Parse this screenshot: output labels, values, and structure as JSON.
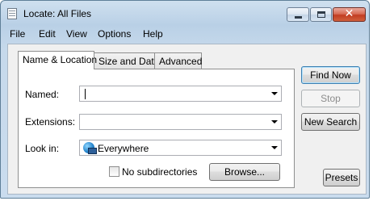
{
  "window": {
    "title": "Locate: All Files",
    "icon": "document-icon",
    "caption_buttons": [
      "minimize",
      "maximize",
      "close"
    ],
    "close_glyph": "✕"
  },
  "menu": [
    "File",
    "Edit",
    "View",
    "Options",
    "Help"
  ],
  "tabs": [
    {
      "label": "Name & Location",
      "active": true
    },
    {
      "label": "Size and Date",
      "active": false
    },
    {
      "label": "Advanced",
      "active": false
    }
  ],
  "form": {
    "named": {
      "label": "Named:",
      "value": ""
    },
    "extensions": {
      "label": "Extensions:",
      "value": ""
    },
    "look_in": {
      "label": "Look in:",
      "value": "Everywhere",
      "icon": "globe-computer-icon"
    },
    "no_subdirectories": {
      "label": "No subdirectories",
      "checked": false
    },
    "browse_label": "Browse..."
  },
  "buttons": {
    "find_now": "Find Now",
    "stop": "Stop",
    "new_search": "New Search",
    "presets": "Presets"
  },
  "colors": {
    "title_close_red": "#c23d22",
    "default_button_border": "#3c7fb1",
    "disabled_text": "#8c8c8c"
  }
}
